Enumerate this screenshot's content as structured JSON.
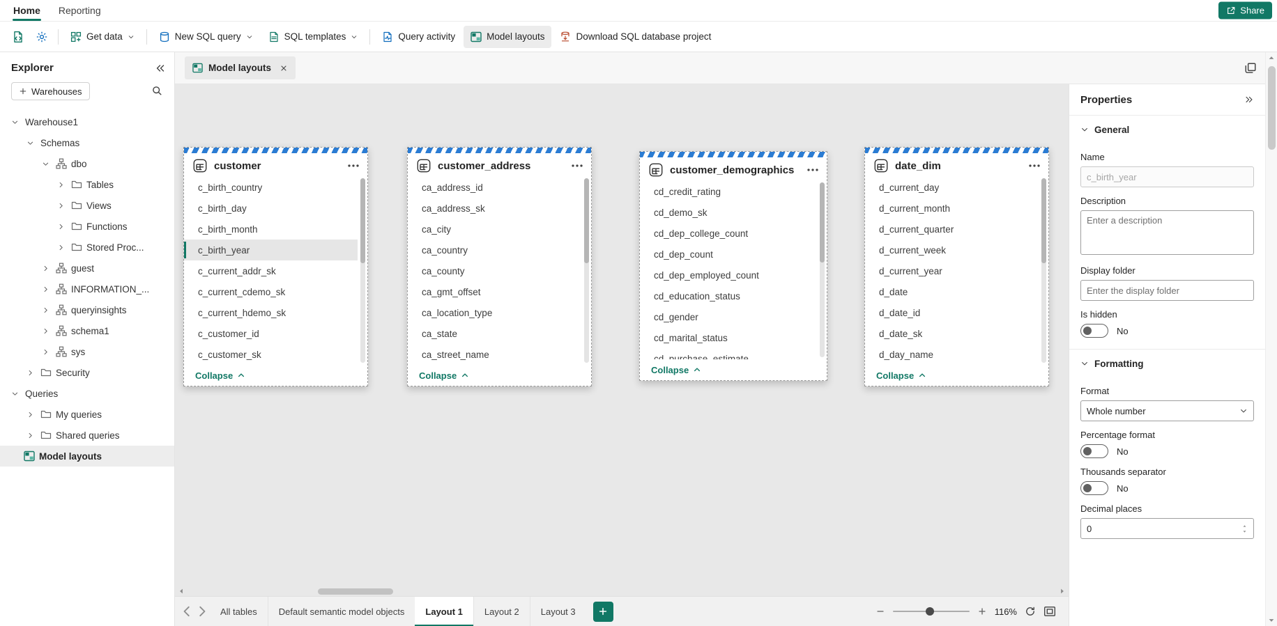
{
  "theme": {
    "accent": "#117865",
    "stripe_blue": "#2b7cd3",
    "canvas_background": "#e8e8e8"
  },
  "menubar": {
    "tabs": [
      {
        "label": "Home"
      },
      {
        "label": "Reporting"
      }
    ],
    "share_label": "Share"
  },
  "toolbar": {
    "buttons": [
      {
        "label": "Get data"
      },
      {
        "label": "New SQL query"
      },
      {
        "label": "SQL templates"
      },
      {
        "label": "Query activity"
      },
      {
        "label": "Model layouts"
      },
      {
        "label": "Download SQL database project"
      }
    ]
  },
  "explorer": {
    "title": "Explorer",
    "warehouses_button": "Warehouses",
    "tree": [
      {
        "label": "Warehouse1"
      },
      {
        "label": "Schemas"
      },
      {
        "label": "dbo"
      },
      {
        "label": "Tables"
      },
      {
        "label": "Views"
      },
      {
        "label": "Functions"
      },
      {
        "label": "Stored Proc..."
      },
      {
        "label": "guest"
      },
      {
        "label": "INFORMATION_..."
      },
      {
        "label": "queryinsights"
      },
      {
        "label": "schema1"
      },
      {
        "label": "sys"
      },
      {
        "label": "Security"
      },
      {
        "label": "Queries"
      },
      {
        "label": "My queries"
      },
      {
        "label": "Shared queries"
      },
      {
        "label": "Model layouts"
      }
    ]
  },
  "tabstrip": {
    "doc_tab": "Model layouts"
  },
  "canvas": {
    "collapse_label": "Collapse",
    "cards": [
      {
        "title": "customer",
        "selected_field": "c_birth_year",
        "fields": [
          "c_birth_country",
          "c_birth_day",
          "c_birth_month",
          "c_birth_year",
          "c_current_addr_sk",
          "c_current_cdemo_sk",
          "c_current_hdemo_sk",
          "c_customer_id",
          "c_customer_sk"
        ]
      },
      {
        "title": "customer_address",
        "fields": [
          "ca_address_id",
          "ca_address_sk",
          "ca_city",
          "ca_country",
          "ca_county",
          "ca_gmt_offset",
          "ca_location_type",
          "ca_state",
          "ca_street_name"
        ]
      },
      {
        "title": "customer_demographics",
        "fields": [
          "cd_credit_rating",
          "cd_demo_sk",
          "cd_dep_college_count",
          "cd_dep_count",
          "cd_dep_employed_count",
          "cd_education_status",
          "cd_gender",
          "cd_marital_status",
          "cd_purchase_estimate"
        ]
      },
      {
        "title": "date_dim",
        "fields": [
          "d_current_day",
          "d_current_month",
          "d_current_quarter",
          "d_current_week",
          "d_current_year",
          "d_date",
          "d_date_id",
          "d_date_sk",
          "d_day_name"
        ]
      }
    ]
  },
  "bottombar": {
    "tabs": [
      "All tables",
      "Default semantic model objects",
      "Layout 1",
      "Layout 2",
      "Layout 3"
    ],
    "zoom": "116%"
  },
  "properties": {
    "title": "Properties",
    "general": {
      "label": "General",
      "name_label": "Name",
      "name_value": "c_birth_year",
      "description_label": "Description",
      "description_placeholder": "Enter a description",
      "display_folder_label": "Display folder",
      "display_folder_placeholder": "Enter the display folder",
      "is_hidden_label": "Is hidden",
      "is_hidden_value": "No"
    },
    "formatting": {
      "label": "Formatting",
      "format_label": "Format",
      "format_value": "Whole number",
      "percentage_label": "Percentage format",
      "percentage_value": "No",
      "thousands_label": "Thousands separator",
      "thousands_value": "No",
      "decimal_label": "Decimal places",
      "decimal_value": "0"
    }
  }
}
